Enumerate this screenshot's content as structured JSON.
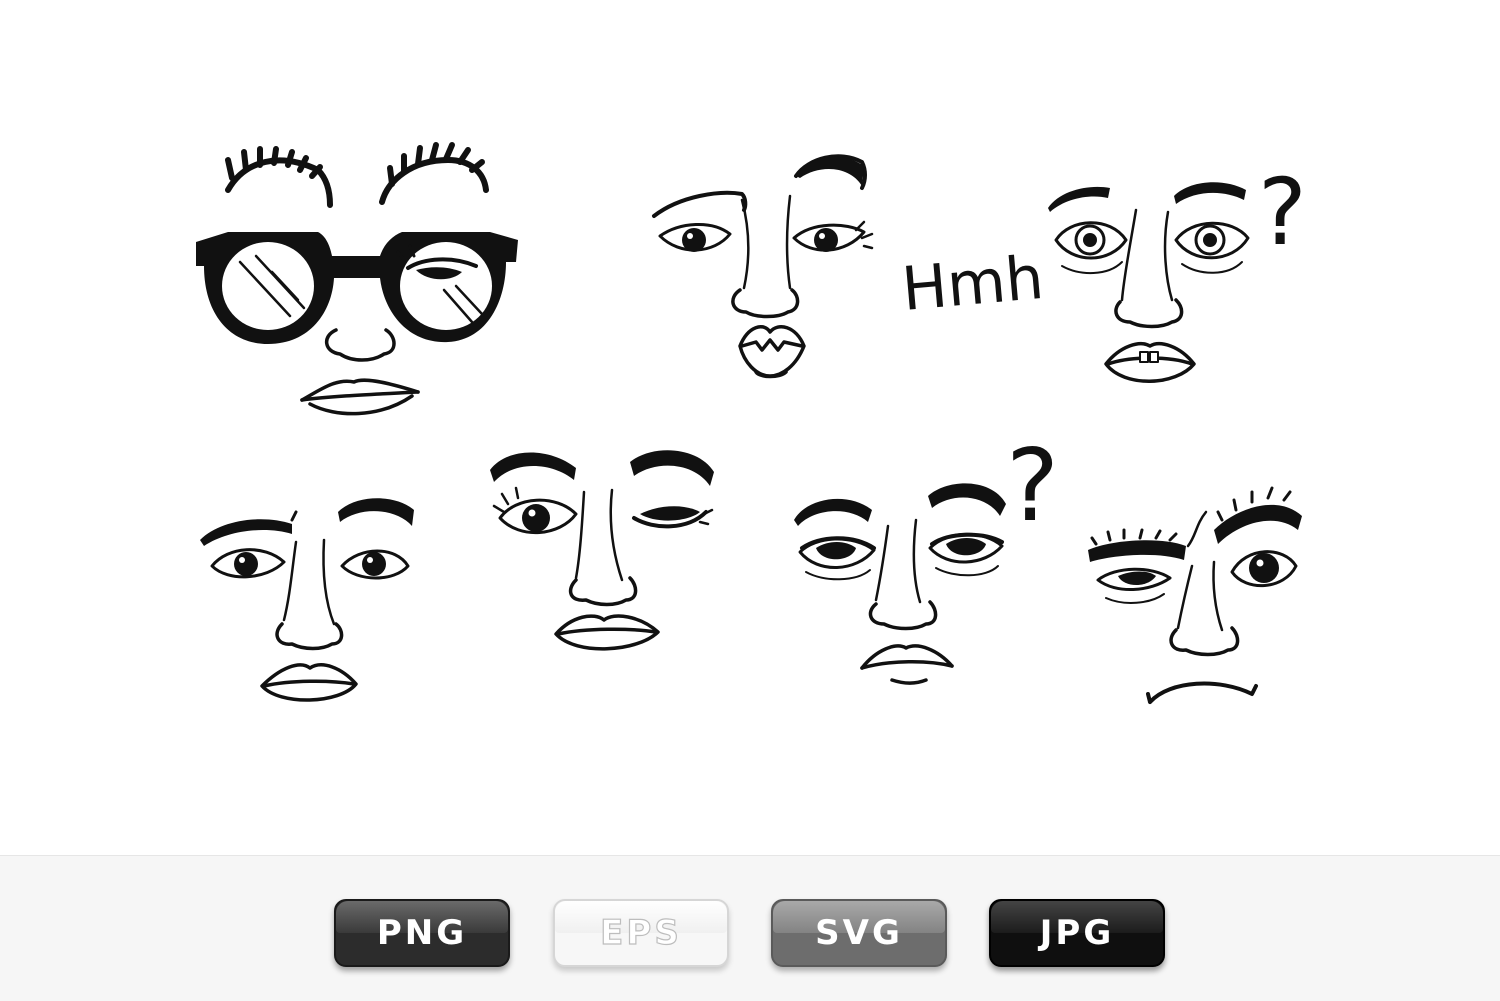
{
  "illustration": {
    "annotations": {
      "hmh_text": "Hmh",
      "question_mark_1": "?",
      "question_mark_2": "?"
    },
    "faces": [
      {
        "expression": "glasses-smirk"
      },
      {
        "expression": "kissy-lips"
      },
      {
        "expression": "surprised"
      },
      {
        "expression": "neutral"
      },
      {
        "expression": "wink"
      },
      {
        "expression": "doubtful"
      },
      {
        "expression": "angry"
      }
    ]
  },
  "footer": {
    "formats": [
      {
        "label": "PNG",
        "color": "#2c2c2c"
      },
      {
        "label": "EPS",
        "color": "#f7f7f7"
      },
      {
        "label": "SVG",
        "color": "#6d6d6d"
      },
      {
        "label": "JPG",
        "color": "#0f0f0f"
      }
    ]
  }
}
